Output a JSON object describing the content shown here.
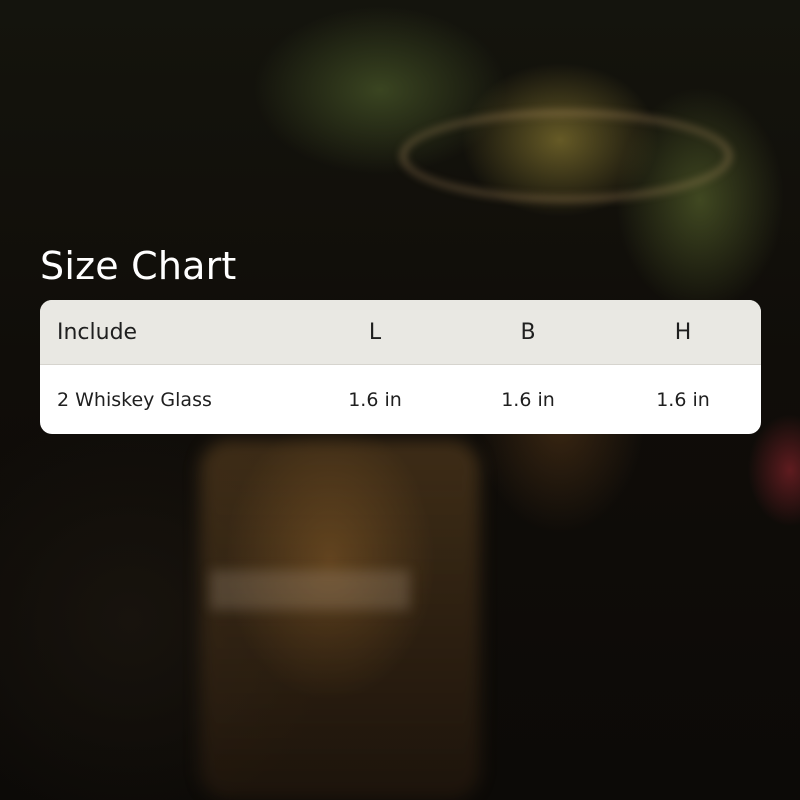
{
  "title": "Size Chart",
  "table": {
    "headers": {
      "include": "Include",
      "l": "L",
      "b": "B",
      "h": "H"
    },
    "rows": [
      {
        "include": "2 Whiskey Glass",
        "l": "1.6 in",
        "b": "1.6 in",
        "h": "1.6 in"
      }
    ]
  }
}
